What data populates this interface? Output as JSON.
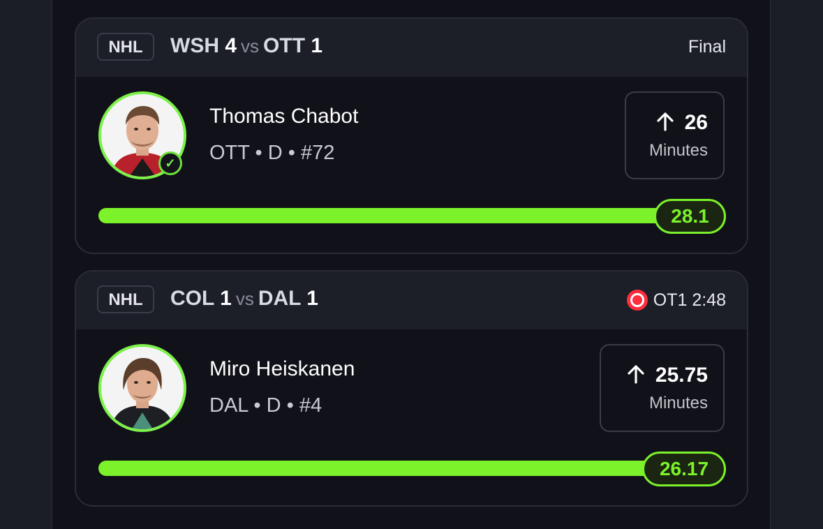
{
  "cards": [
    {
      "league": "NHL",
      "team_a": "WSH",
      "score_a": "4",
      "vs": "vs",
      "team_b": "OTT",
      "score_b": "1",
      "status": "Final",
      "live": false,
      "player": {
        "name": "Thomas Chabot",
        "meta": "OTT • D • #72",
        "avatar": "player-headshot",
        "completed_check": true
      },
      "stat": {
        "line": "26",
        "direction": "up-arrow-icon",
        "label": "Minutes"
      },
      "progress": {
        "value": "28.1",
        "fraction": 1.0
      }
    },
    {
      "league": "NHL",
      "team_a": "COL",
      "score_a": "1",
      "vs": "vs",
      "team_b": "DAL",
      "score_b": "1",
      "status": "OT1 2:48",
      "live": true,
      "player": {
        "name": "Miro Heiskanen",
        "meta": "DAL • D • #4",
        "avatar": "player-headshot",
        "completed_check": false
      },
      "stat": {
        "line": "25.75",
        "direction": "up-arrow-icon",
        "label": "Minutes"
      },
      "progress": {
        "value": "26.17",
        "fraction": 1.0
      }
    }
  ],
  "colors": {
    "accent": "#7cf22a",
    "live": "#ff2d3d",
    "card_bg": "#111219",
    "header_bg": "#1d1f28",
    "page_bg": "#1c1e26"
  }
}
